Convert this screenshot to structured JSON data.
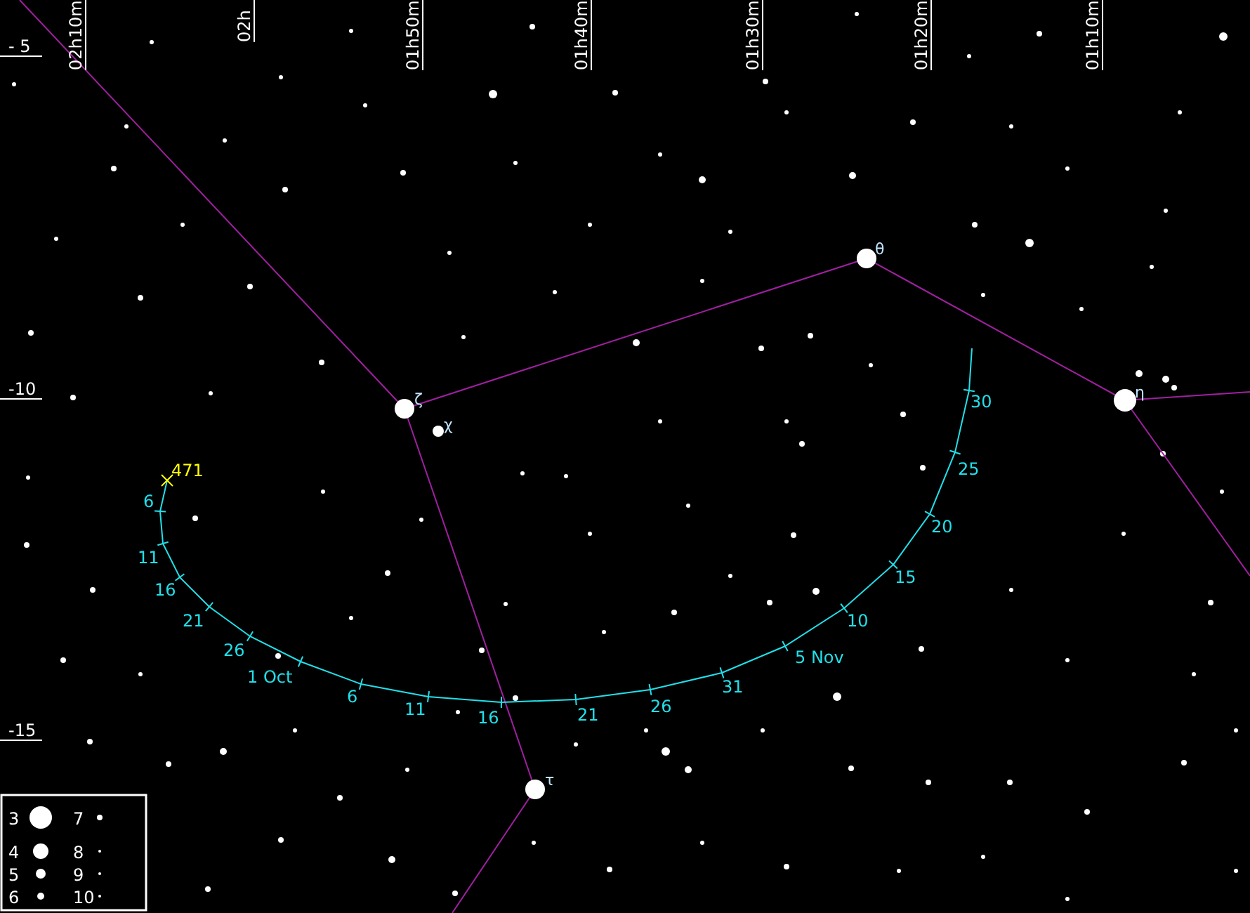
{
  "ra_labels": [
    {
      "label": "02h10m"
    },
    {
      "label": "02h"
    },
    {
      "label": "01h50m"
    },
    {
      "label": "01h40m"
    },
    {
      "label": "01h30m"
    },
    {
      "label": "01h20m"
    },
    {
      "label": "01h10m"
    }
  ],
  "dec_labels": [
    {
      "label": "- 5"
    },
    {
      "label": "-10"
    },
    {
      "label": "-15"
    }
  ],
  "stars": [
    {
      "label": "ζ"
    },
    {
      "label": "θ"
    },
    {
      "label": "η"
    },
    {
      "label": "τ"
    },
    {
      "label": "χ"
    }
  ],
  "track": {
    "label": "471",
    "dates": [
      "6",
      "11",
      "16",
      "21",
      "26",
      "1 Oct",
      "6",
      "11",
      "16",
      "21",
      "26",
      "31",
      "5 Nov",
      "10",
      "15",
      "20",
      "25",
      "30"
    ]
  },
  "legend": [
    {
      "mag": "3"
    },
    {
      "mag": "4"
    },
    {
      "mag": "5"
    },
    {
      "mag": "6"
    },
    {
      "mag": "7"
    },
    {
      "mag": "8"
    },
    {
      "mag": "9"
    },
    {
      "mag": "10"
    }
  ]
}
